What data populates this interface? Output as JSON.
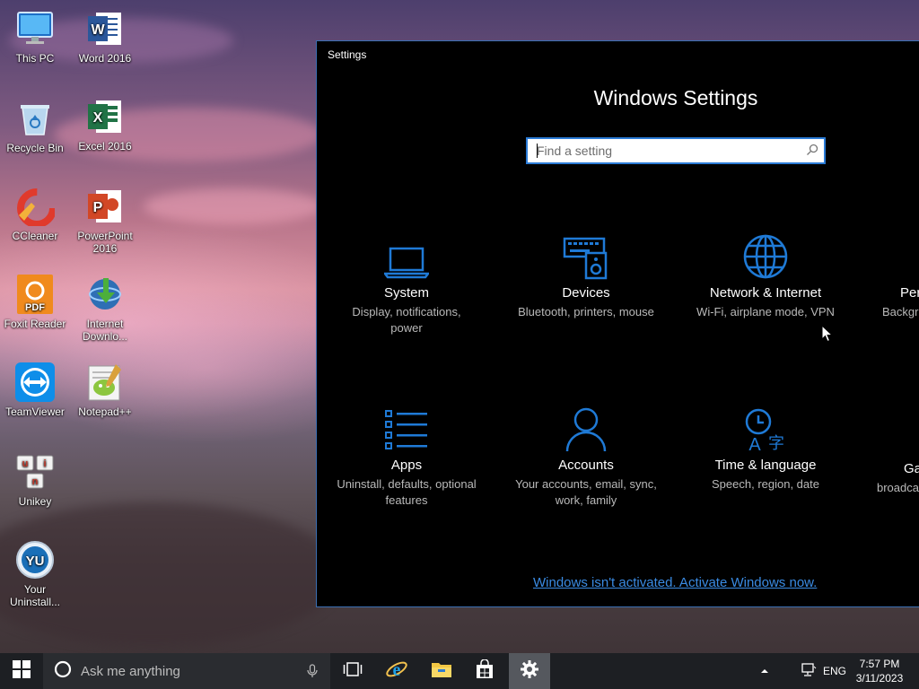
{
  "desktop": {
    "icons": [
      {
        "label": "This PC"
      },
      {
        "label": "Word 2016"
      },
      {
        "label": "Recycle Bin"
      },
      {
        "label": "Excel 2016"
      },
      {
        "label": "CCleaner"
      },
      {
        "label": "PowerPoint 2016"
      },
      {
        "label": "Foxit Reader"
      },
      {
        "label": "Internet Downlo..."
      },
      {
        "label": "TeamViewer"
      },
      {
        "label": "Notepad++"
      },
      {
        "label": "Unikey"
      },
      {
        "label": "Your Uninstall..."
      }
    ]
  },
  "settings": {
    "window_title": "Settings",
    "heading": "Windows Settings",
    "search_placeholder": "Find a setting",
    "categories": [
      {
        "name": "System",
        "desc": "Display, notifications, power",
        "icon": "laptop-icon"
      },
      {
        "name": "Devices",
        "desc": "Bluetooth, printers, mouse",
        "icon": "devices-icon"
      },
      {
        "name": "Network & Internet",
        "desc": "Wi-Fi, airplane mode, VPN",
        "icon": "globe-icon"
      },
      {
        "name": "Per",
        "desc": "Backgro",
        "icon": "personalization-icon"
      },
      {
        "name": "Apps",
        "desc": "Uninstall, defaults, optional features",
        "icon": "apps-list-icon"
      },
      {
        "name": "Accounts",
        "desc": "Your accounts, email, sync, work, family",
        "icon": "person-icon"
      },
      {
        "name": "Time & language",
        "desc": "Speech, region, date",
        "icon": "time-language-icon"
      },
      {
        "name": "Ga",
        "desc": "broadca",
        "icon": "gaming-icon"
      }
    ],
    "activation_link": "Windows isn't activated. Activate Windows now.",
    "accent_color": "#1f7ad6"
  },
  "taskbar": {
    "search_placeholder": "Ask me anything",
    "language": "ENG",
    "time": "7:57 PM",
    "date": "3/11/2023",
    "background_color": "#1d1f23"
  }
}
